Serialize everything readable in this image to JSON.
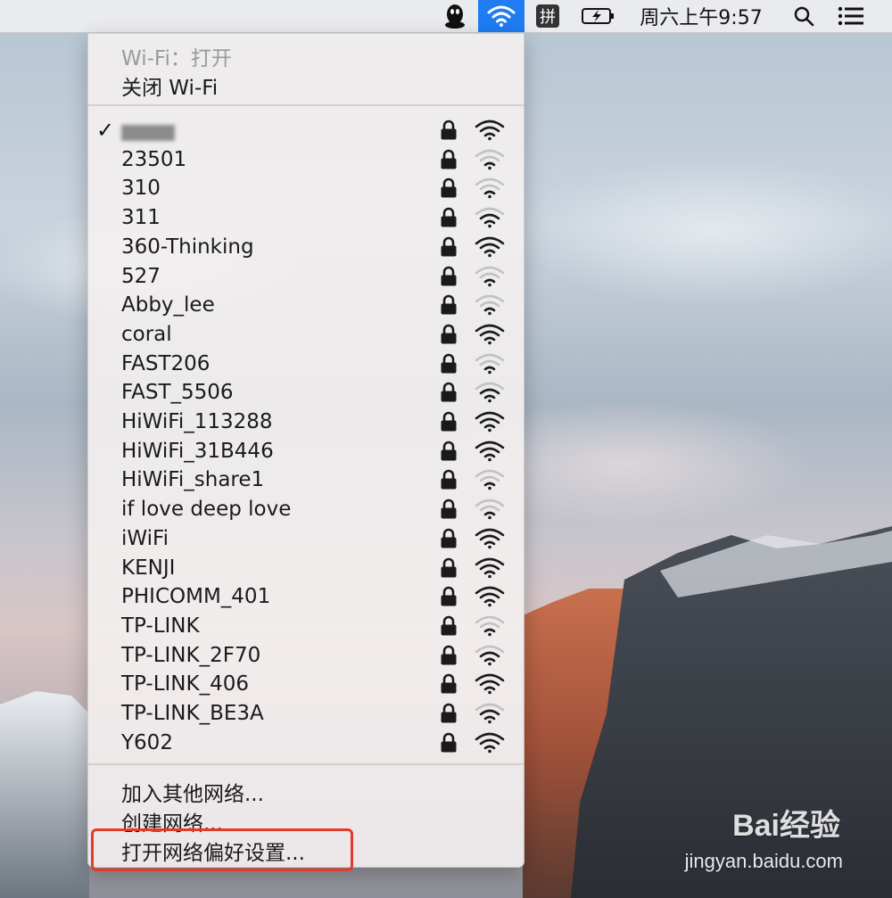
{
  "menubar": {
    "icons": [
      "qq-penguin-icon",
      "wifi-icon",
      "input-method-icon",
      "battery-charging-icon",
      "spotlight-search-icon",
      "notification-center-icon"
    ],
    "input_method_label": "拼",
    "clock": "周六上午9:57"
  },
  "wifi_menu": {
    "status": "Wi-Fi：打开",
    "toggle_label": "关闭 Wi-Fi",
    "networks": [
      {
        "name": "",
        "connected": true,
        "secured": true,
        "signal": 3
      },
      {
        "name": "23501",
        "secured": true,
        "signal": 1
      },
      {
        "name": "310",
        "secured": true,
        "signal": 1
      },
      {
        "name": "311",
        "secured": true,
        "signal": 2
      },
      {
        "name": "360-Thinking",
        "secured": true,
        "signal": 3
      },
      {
        "name": "527",
        "secured": true,
        "signal": 1
      },
      {
        "name": "Abby_lee",
        "secured": true,
        "signal": 1
      },
      {
        "name": "coral",
        "secured": true,
        "signal": 3
      },
      {
        "name": "FAST206",
        "secured": true,
        "signal": 1
      },
      {
        "name": "FAST_5506",
        "secured": true,
        "signal": 2
      },
      {
        "name": "HiWiFi_113288",
        "secured": true,
        "signal": 3
      },
      {
        "name": "HiWiFi_31B446",
        "secured": true,
        "signal": 3
      },
      {
        "name": "HiWiFi_share1",
        "secured": true,
        "signal": 1
      },
      {
        "name": "if love deep love",
        "secured": true,
        "signal": 1
      },
      {
        "name": "iWiFi",
        "secured": true,
        "signal": 3
      },
      {
        "name": "KENJI",
        "secured": true,
        "signal": 3
      },
      {
        "name": "PHICOMM_401",
        "secured": true,
        "signal": 3
      },
      {
        "name": "TP-LINK",
        "secured": true,
        "signal": 1
      },
      {
        "name": "TP-LINK_2F70",
        "secured": true,
        "signal": 2
      },
      {
        "name": "TP-LINK_406",
        "secured": true,
        "signal": 3
      },
      {
        "name": "TP-LINK_BE3A",
        "secured": true,
        "signal": 2
      },
      {
        "name": "Y602",
        "secured": true,
        "signal": 3
      }
    ],
    "join_other": "加入其他网络...",
    "create_network": "创建网络...",
    "open_preferences": "打开网络偏好设置..."
  },
  "watermark": {
    "brand": "Bai经验",
    "url": "jingyan.baidu.com"
  },
  "colors": {
    "highlight_accent": "#1f7cf3",
    "annotation_red": "#e53a2a"
  }
}
